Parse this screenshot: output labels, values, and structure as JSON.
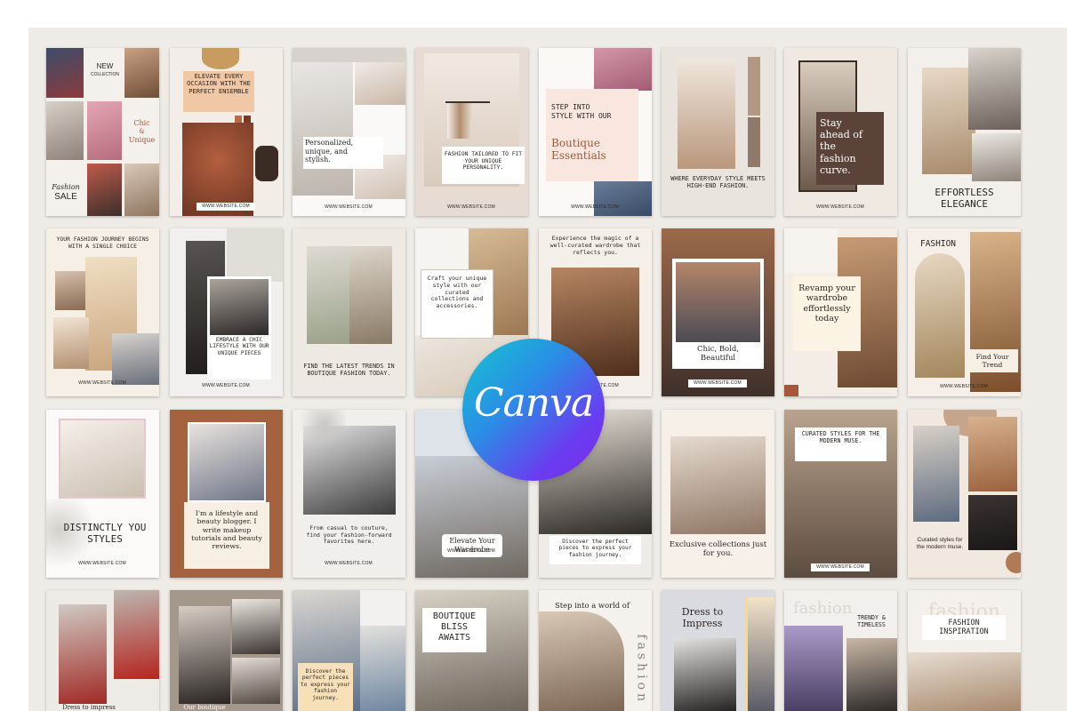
{
  "colors": {
    "board": "#efebe7",
    "canva_start": "#16c6d1",
    "canva_end": "#7d2ae8"
  },
  "canva": {
    "logo_text": "Canva"
  },
  "website": "WWW.WEBSITE.COM",
  "row1": {
    "t1": {
      "new": "NEW",
      "collection": "COLLECTION",
      "chic": "Chic",
      "amp": "&",
      "unique": "Unique",
      "fashion": "Fashion",
      "sale": "SALE"
    },
    "t2": {
      "headline": "ELEVATE EVERY OCCASION WITH THE PERFECT ENSEMBLE"
    },
    "t3": {
      "headline": "Personalized, unique, and stylish."
    },
    "t4": {
      "headline": "FASHION TAILORED TO FIT YOUR UNIQUE PERSONALITY."
    },
    "t5": {
      "line1": "STEP INTO STYLE WITH OUR",
      "line2": "Boutique Essentials"
    },
    "t6": {
      "headline": "WHERE EVERYDAY STYLE MEETS HIGH-END FASHION."
    },
    "t7": {
      "headline": "Stay ahead of the fashion curve."
    },
    "t8": {
      "headline": "EFFORTLESS ELEGANCE"
    }
  },
  "row2": {
    "t1": {
      "headline": "YOUR FASHION JOURNEY BEGINS WITH A SINGLE CHOICE"
    },
    "t2": {
      "headline": "EMBRACE A CHIC LIFESTYLE WITH OUR UNIQUE PIECES"
    },
    "t3": {
      "headline": "FIND THE LATEST TRENDS IN BOUTIQUE FASHION TODAY."
    },
    "t4": {
      "headline": "Craft your unique style with our curated collections and accessories."
    },
    "t5": {
      "headline": "Experience the magic of a well-curated wardrobe that reflects you."
    },
    "t6": {
      "headline": "Chic, Bold, Beautiful"
    },
    "t7": {
      "headline": "Revamp your wardrobe effortlessly today"
    },
    "t8": {
      "title": "FASHION",
      "caption": "Find Your Trend"
    }
  },
  "row3": {
    "t1": {
      "headline": "DISTINCTLY YOU STYLES"
    },
    "t2": {
      "headline": "I'm a lifestyle and beauty blogger. I write makeup tutorials and beauty reviews."
    },
    "t3": {
      "headline": "From casual to couture, find your fashion-forward favorites here."
    },
    "t4": {
      "headline": "Elevate Your Wardrobe"
    },
    "t5": {
      "headline": "Discover the perfect pieces to express your fashion journey."
    },
    "t6": {
      "headline": "Exclusive collections just for you."
    },
    "t7": {
      "headline": "CURATED STYLES FOR THE MODERN MUSE."
    },
    "t8": {
      "headline": "Curated styles for the modern muse."
    }
  },
  "row4": {
    "t1": {
      "headline": "Dress to impress"
    },
    "t2": {
      "headline": "Our boutique"
    },
    "t3": {
      "headline": "Discover the perfect pieces to express your fashion journey."
    },
    "t4": {
      "headline": "BOUTIQUE BLISS AWAITS"
    },
    "t5": {
      "headline": "Step into a world of",
      "vertical": "fashion"
    },
    "t6": {
      "headline": "Dress to Impress"
    },
    "t7": {
      "bg": "fashion",
      "headline": "TRENDY & TIMELESS"
    },
    "t8": {
      "bg": "fashion",
      "headline": "FASHION INSPIRATION"
    }
  }
}
